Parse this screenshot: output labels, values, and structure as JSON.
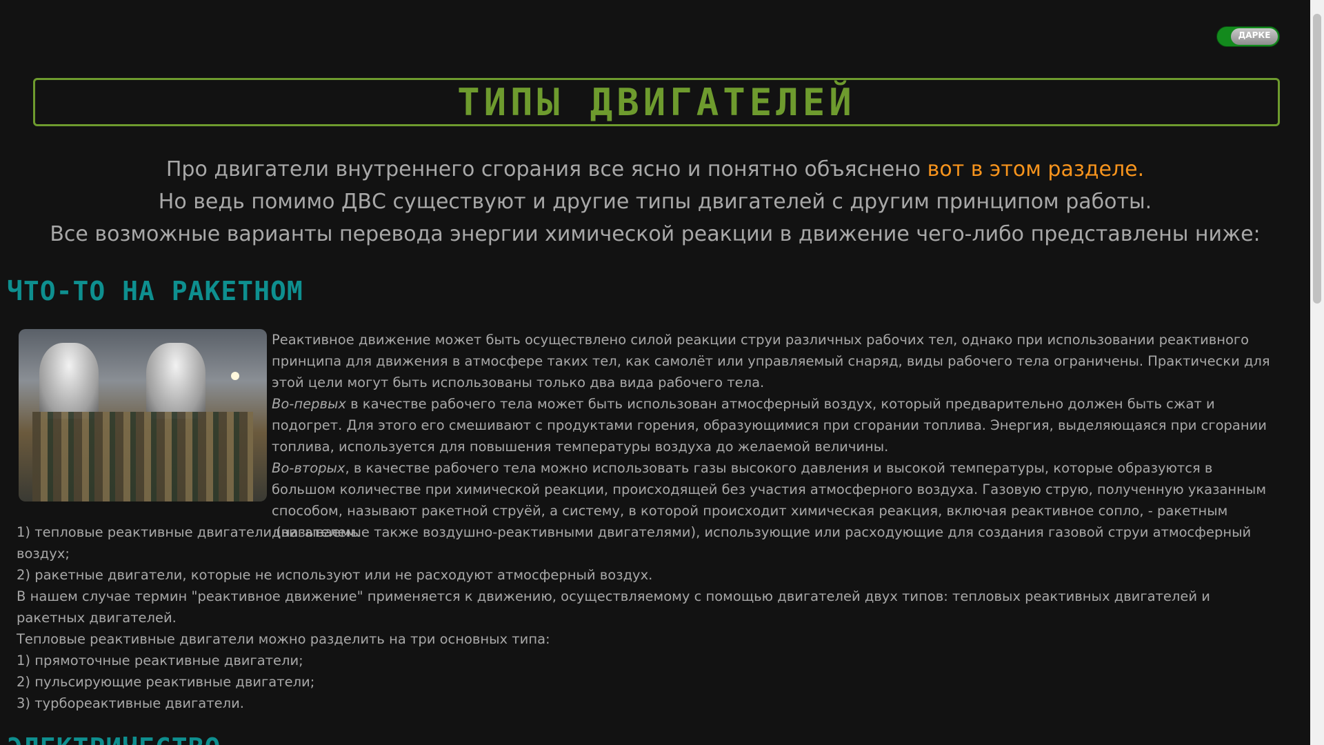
{
  "theme_toggle": {
    "label": "ДАРКЕ"
  },
  "page_title": "ТИПЫ ДВИГАТЕЛЕЙ",
  "intro": {
    "line1_text": "Про двигатели внутреннего сгорания все ясно и понятно объяснено ",
    "line1_link": "вот в этом разделе.",
    "line2": "Но ведь помимо ДВС существуют и другие типы двигателей с другим принципом работы.",
    "line3": "Все возможные варианты перевода энергии химической реакции в движение чего-либо представлены ниже:"
  },
  "section_rocket": {
    "heading": "ЧТО-ТО НА РАКЕТНОМ",
    "paragraphs": {
      "p1": "Реактивное движение может быть осуществлено силой реакции струи различных рабочих тел, однако при использовании реактивного принципа для движения в атмосфере таких тел, как самолёт или управляемый снаряд, виды рабочего тела ограничены. Практически для этой цели могут быть использованы только два вида рабочего тела.",
      "p2_em": "Во-первых",
      "p2": " в качестве рабочего тела может быть использован атмосферный воздух, который предварительно должен быть сжат и подогрет. Для этого его смешивают с продуктами горения, образующимися при сгорании топлива. Энергия, выделяющаяся при сгорании топлива, используется для повышения температуры воздуха до желаемой величины.",
      "p3_em": "Во-вторых",
      "p3": ", в качестве рабочего тела можно использовать газы высокого давления и высокой температуры, которые образуются в большом количестве при химической реакции, происходящей без участия атмосферного воздуха. Газовую струю, полученную указанным способом, называют ракетной струёй, а систему, в которой происходит химическая реакция, включая реактивное сопло, - ракетным двигателем.",
      "p4": "1) тепловые реактивные двигатели (называемые также воздушно-реактивными двигателями), использующие или расходующие для создания газовой струи атмосферный воздух;",
      "p5": "2) ракетные двигатели, которые не используют или не расходуют атмосферный воздух.",
      "p6": "В нашем случае термин \"реактивное движение\" применяется к движению, осуществляемому с помощью двигателей двух типов: тепловых реактивных двигателей и ракетных двигателей.",
      "p7": "Тепловые реактивные двигатели можно разделить на три основных типа:",
      "p8": "1) прямоточные реактивные двигатели;",
      "p9": "2) пульсирующие реактивные двигатели;",
      "p10": "3) турбореактивные двигатели."
    }
  },
  "section_next": {
    "heading": "ЭЛЕКТРИЧЕСТВО"
  }
}
